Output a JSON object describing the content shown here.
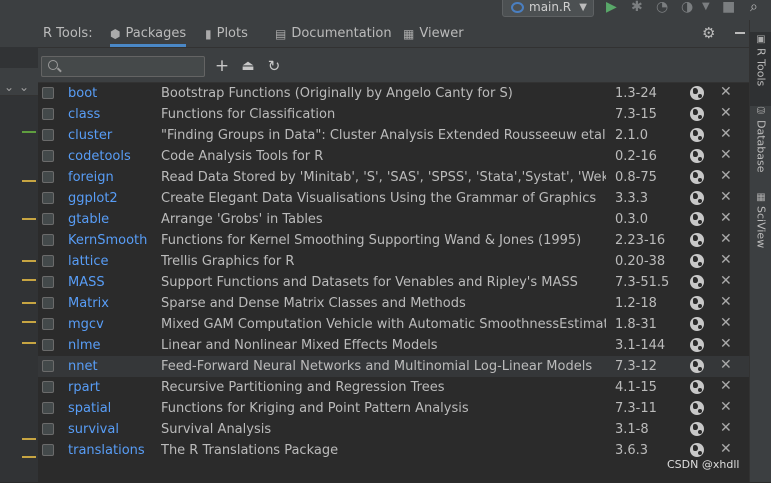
{
  "run_config": {
    "label": "main.R"
  },
  "header": {
    "title": "R Tools:",
    "tabs": [
      {
        "label": "Packages",
        "icon": "package-icon",
        "active": true
      },
      {
        "label": "Plots",
        "icon": "bar-chart-icon",
        "active": false
      },
      {
        "label": "Documentation",
        "icon": "document-icon",
        "active": false
      },
      {
        "label": "Viewer",
        "icon": "grid-icon",
        "active": false
      }
    ]
  },
  "toolbar": {
    "search_placeholder": "",
    "buttons": [
      "add-icon",
      "upgrade-icon",
      "refresh-icon"
    ]
  },
  "packages": [
    {
      "name": "boot",
      "description": "Bootstrap Functions (Originally by Angelo Canty for S)",
      "version": "1.3-24"
    },
    {
      "name": "class",
      "description": "Functions for Classification",
      "version": "7.3-15"
    },
    {
      "name": "cluster",
      "description": "\"Finding Groups in Data\": Cluster Analysis Extended Rousseeuw etal.",
      "version": "2.1.0"
    },
    {
      "name": "codetools",
      "description": "Code Analysis Tools for R",
      "version": "0.2-16"
    },
    {
      "name": "foreign",
      "description": "Read Data Stored by 'Minitab', 'S', 'SAS', 'SPSS', 'Stata','Systat', 'Weka', 'dBa…",
      "version": "0.8-75"
    },
    {
      "name": "ggplot2",
      "description": "Create Elegant Data Visualisations Using the Grammar of Graphics",
      "version": "3.3.3"
    },
    {
      "name": "gtable",
      "description": "Arrange 'Grobs' in Tables",
      "version": "0.3.0"
    },
    {
      "name": "KernSmooth",
      "description": "Functions for Kernel Smoothing Supporting Wand & Jones (1995)",
      "version": "2.23-16"
    },
    {
      "name": "lattice",
      "description": "Trellis Graphics for R",
      "version": "0.20-38"
    },
    {
      "name": "MASS",
      "description": "Support Functions and Datasets for Venables and Ripley's MASS",
      "version": "7.3-51.5"
    },
    {
      "name": "Matrix",
      "description": "Sparse and Dense Matrix Classes and Methods",
      "version": "1.2-18"
    },
    {
      "name": "mgcv",
      "description": "Mixed GAM Computation Vehicle with Automatic SmoothnessEstimation",
      "version": "1.8-31"
    },
    {
      "name": "nlme",
      "description": "Linear and Nonlinear Mixed Effects Models",
      "version": "3.1-144"
    },
    {
      "name": "nnet",
      "description": "Feed-Forward Neural Networks and Multinomial Log-Linear Models",
      "version": "7.3-12",
      "selected": true
    },
    {
      "name": "rpart",
      "description": "Recursive Partitioning and Regression Trees",
      "version": "4.1-15"
    },
    {
      "name": "spatial",
      "description": "Functions for Kriging and Point Pattern Analysis",
      "version": "7.3-11"
    },
    {
      "name": "survival",
      "description": "Survival Analysis",
      "version": "3.1-8"
    },
    {
      "name": "translations",
      "description": "The R Translations Package",
      "version": "3.6.3"
    }
  ],
  "right_sidebar": [
    {
      "label": "R Tools",
      "icon": "r-tools-icon",
      "active": true
    },
    {
      "label": "Database",
      "icon": "database-icon",
      "active": false
    },
    {
      "label": "SciView",
      "icon": "sciview-icon",
      "active": false
    }
  ],
  "watermark": "CSDN @xhdll",
  "colors": {
    "background": "#2b2b2b",
    "panel": "#3c3f41",
    "link": "#589df6",
    "active_tab_underline": "#4a88c7",
    "selected_row": "#353739"
  }
}
